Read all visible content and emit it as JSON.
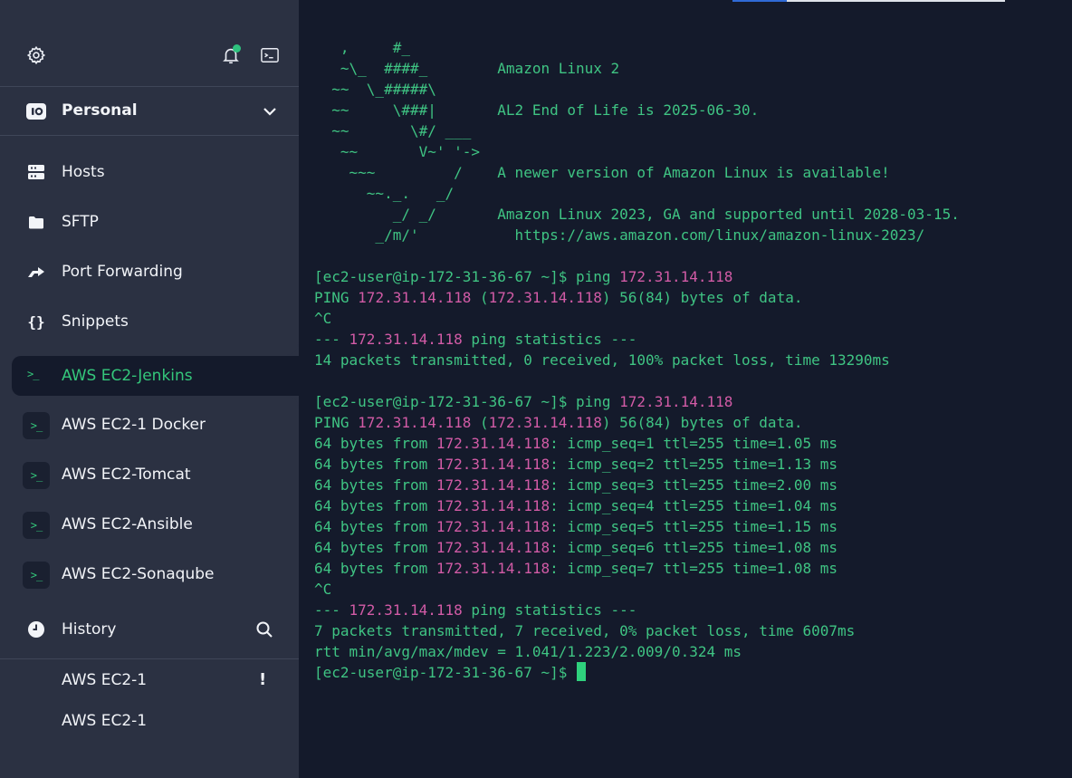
{
  "sidebar": {
    "vault_label": "Personal",
    "nav": [
      {
        "label": "Hosts",
        "icon": "hosts-icon"
      },
      {
        "label": "SFTP",
        "icon": "folder-icon"
      },
      {
        "label": "Port Forwarding",
        "icon": "port-forwarding-icon"
      },
      {
        "label": "Snippets",
        "icon": "braces-icon"
      }
    ],
    "hosts": [
      {
        "label": "AWS EC2-Jenkins",
        "active": true
      },
      {
        "label": "AWS EC2-1 Docker"
      },
      {
        "label": "AWS EC2-Tomcat"
      },
      {
        "label": "AWS EC2-Ansible"
      },
      {
        "label": "AWS EC2-Sonaqube"
      }
    ],
    "history_label": "History",
    "history_items": [
      {
        "label": "AWS EC2-1",
        "warning": "!"
      },
      {
        "label": "AWS EC2-1"
      }
    ],
    "terminal_glyph": ">_"
  },
  "terminal": {
    "motd": [
      "   ,     #_",
      "   ~\\_  ####_        Amazon Linux 2",
      "  ~~  \\_#####\\",
      "  ~~     \\###|       AL2 End of Life is 2025-06-30.",
      "  ~~       \\#/ ___",
      "   ~~       V~' '->",
      "    ~~~         /    A newer version of Amazon Linux is available!",
      "      ~~._.   _/",
      "         _/ _/       Amazon Linux 2023, GA and supported until 2028-03-15.",
      "       _/m/'           https://aws.amazon.com/linux/amazon-linux-2023/"
    ],
    "prompt": "[ec2-user@ip-172-31-36-67 ~]$ ",
    "ip": "172.31.14.118",
    "first_ping": {
      "cmd": "ping ",
      "ping_header_prefix": "PING ",
      "ping_header_mid": " (",
      "ping_header_suffix": ") 56(84) bytes of data.",
      "interrupt": "^C",
      "stats_prefix": "--- ",
      "stats_suffix": " ping statistics ---",
      "summary": "14 packets transmitted, 0 received, 100% packet loss, time 13290ms"
    },
    "second_ping": {
      "replies": [
        {
          "seq": "icmp_seq=1",
          "ttl": "ttl=255",
          "time": "time=1.05 ms"
        },
        {
          "seq": "icmp_seq=2",
          "ttl": "ttl=255",
          "time": "time=1.13 ms"
        },
        {
          "seq": "icmp_seq=3",
          "ttl": "ttl=255",
          "time": "time=2.00 ms"
        },
        {
          "seq": "icmp_seq=4",
          "ttl": "ttl=255",
          "time": "time=1.04 ms"
        },
        {
          "seq": "icmp_seq=5",
          "ttl": "ttl=255",
          "time": "time=1.15 ms"
        },
        {
          "seq": "icmp_seq=6",
          "ttl": "ttl=255",
          "time": "time=1.08 ms"
        },
        {
          "seq": "icmp_seq=7",
          "ttl": "ttl=255",
          "time": "time=1.08 ms"
        }
      ],
      "reply_prefix": "64 bytes from ",
      "summary": "7 packets transmitted, 7 received, 0% packet loss, time 6007ms",
      "rtt": "rtt min/avg/max/mdev = 1.041/1.223/2.009/0.324 ms"
    }
  },
  "colors": {
    "sidebar_bg": "#2b3142",
    "terminal_bg": "#141a2b",
    "terminal_text": "#3fc483",
    "ip_highlight": "#d25ba6",
    "accent_green": "#34c77b"
  }
}
